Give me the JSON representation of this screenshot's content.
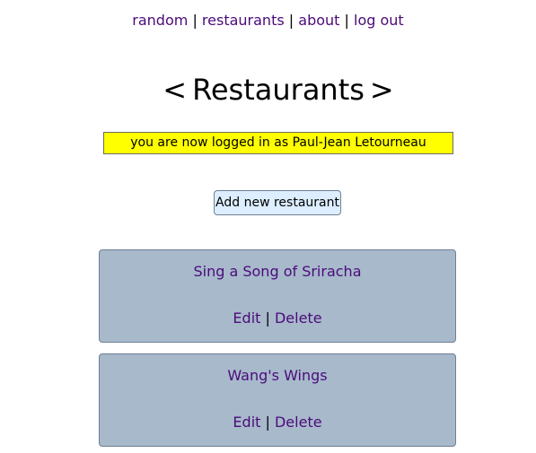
{
  "nav": {
    "links": [
      "random",
      "restaurants",
      "about",
      "log out"
    ],
    "separator": "|"
  },
  "page": {
    "title_left": "<",
    "title": "Restaurants",
    "title_right": ">"
  },
  "flash": {
    "message": "you are now logged in as Paul-Jean Letourneau"
  },
  "actions": {
    "add_label": "Add new restaurant"
  },
  "restaurants": [
    {
      "name": "Sing a Song of Sriracha",
      "edit_label": "Edit",
      "delete_label": "Delete",
      "separator": "|"
    },
    {
      "name": "Wang's Wings",
      "edit_label": "Edit",
      "delete_label": "Delete",
      "separator": "|"
    }
  ],
  "colors": {
    "link": "#4b0b7a",
    "flash_bg": "#ffff00",
    "card_bg": "#a7b9cb",
    "button_bg": "#dceeff"
  }
}
